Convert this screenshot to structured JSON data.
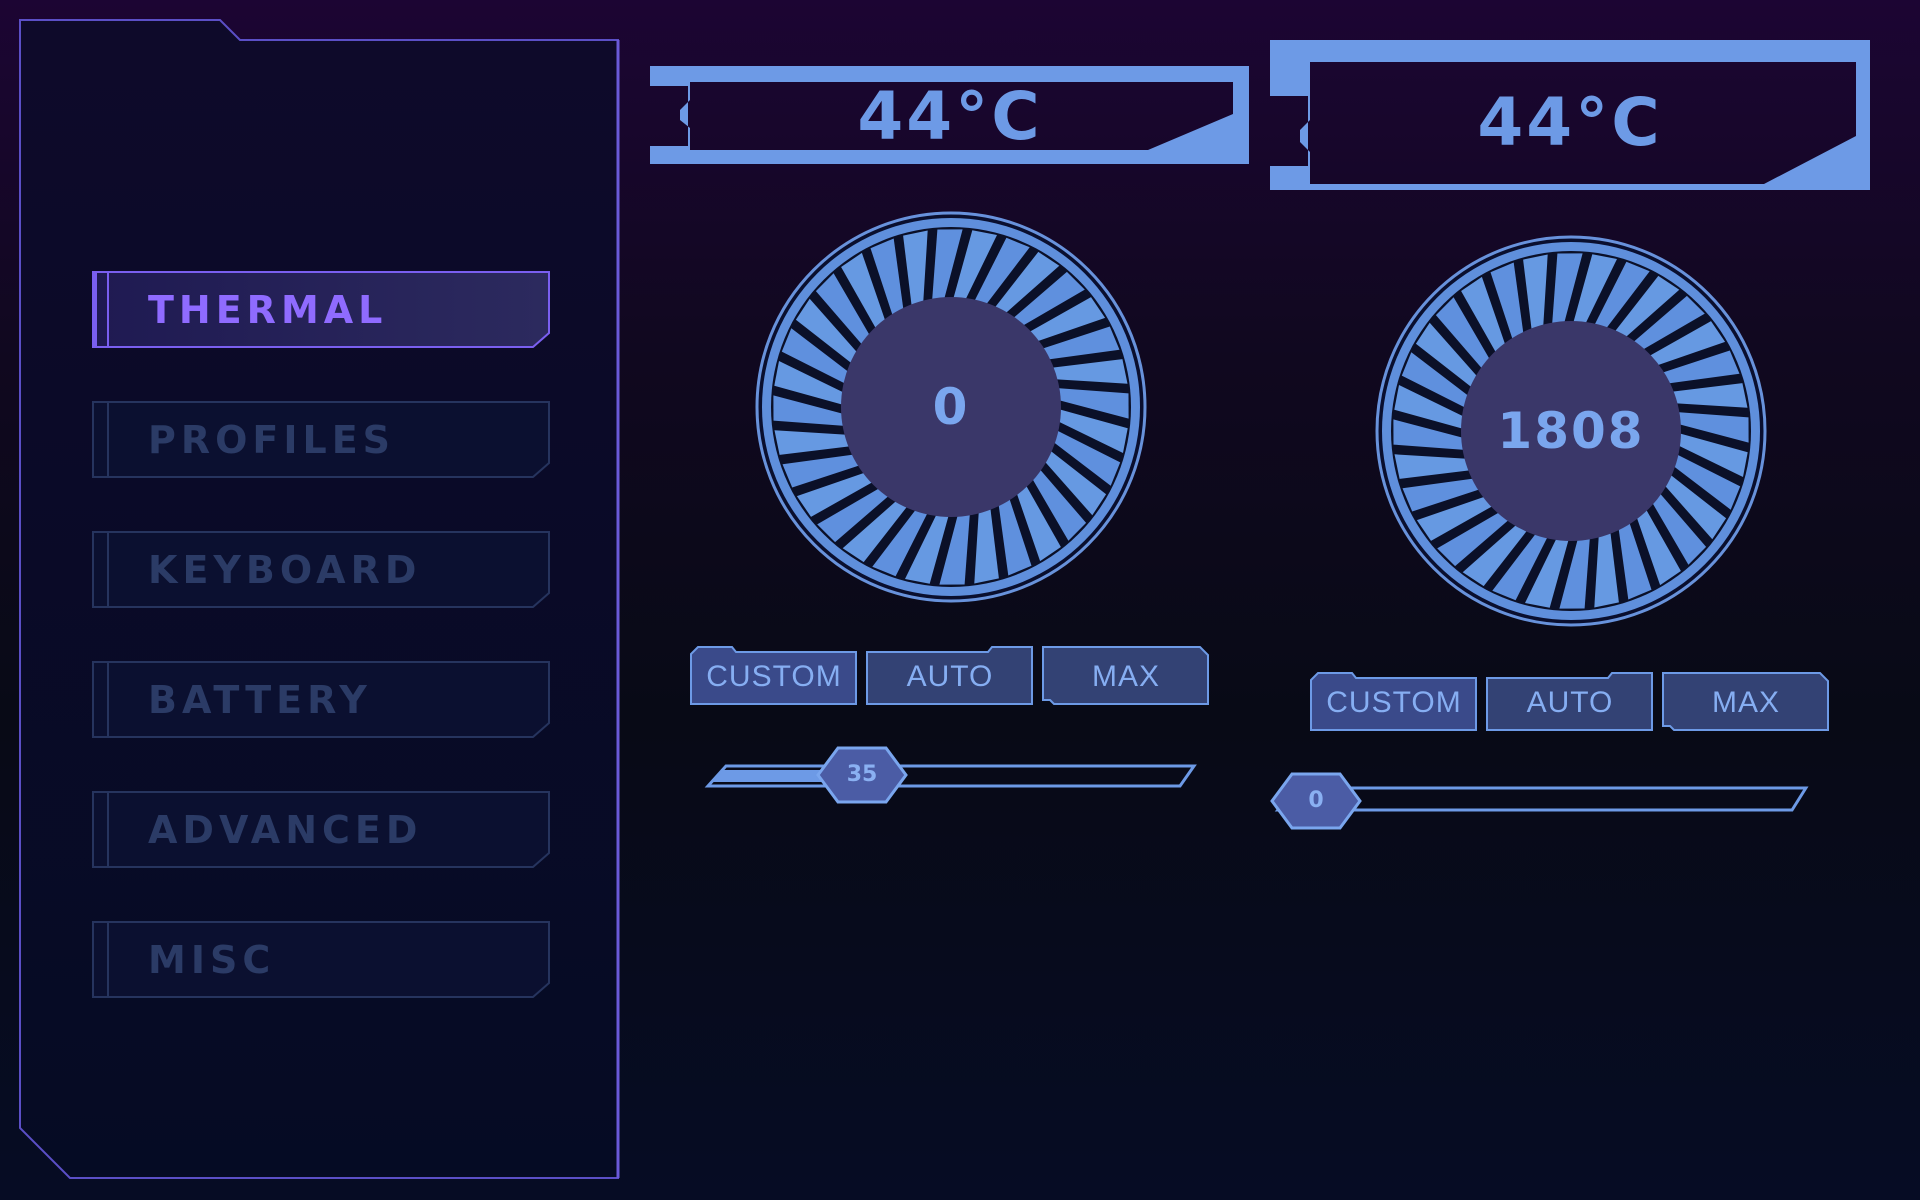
{
  "nav": {
    "items": [
      {
        "label": "THERMAL",
        "active": true
      },
      {
        "label": "PROFILES",
        "active": false
      },
      {
        "label": "KEYBOARD",
        "active": false
      },
      {
        "label": "BATTERY",
        "active": false
      },
      {
        "label": "ADVANCED",
        "active": false
      },
      {
        "label": "MISC",
        "active": false
      }
    ]
  },
  "fans": [
    {
      "temperature": "44°C",
      "rpm": "0",
      "modes": [
        "CUSTOM",
        "AUTO",
        "MAX"
      ],
      "slider_value": "35",
      "slider_fraction": 0.35
    },
    {
      "temperature": "44°C",
      "rpm": "1808",
      "modes": [
        "CUSTOM",
        "AUTO",
        "MAX"
      ],
      "slider_value": "0",
      "slider_fraction": 0
    }
  ],
  "colors": {
    "accent_active": "#8f6bff",
    "accent_blue": "#6d9ae6",
    "inactive_text": "#2b3b66",
    "panel_border": "#6a5ad8"
  }
}
